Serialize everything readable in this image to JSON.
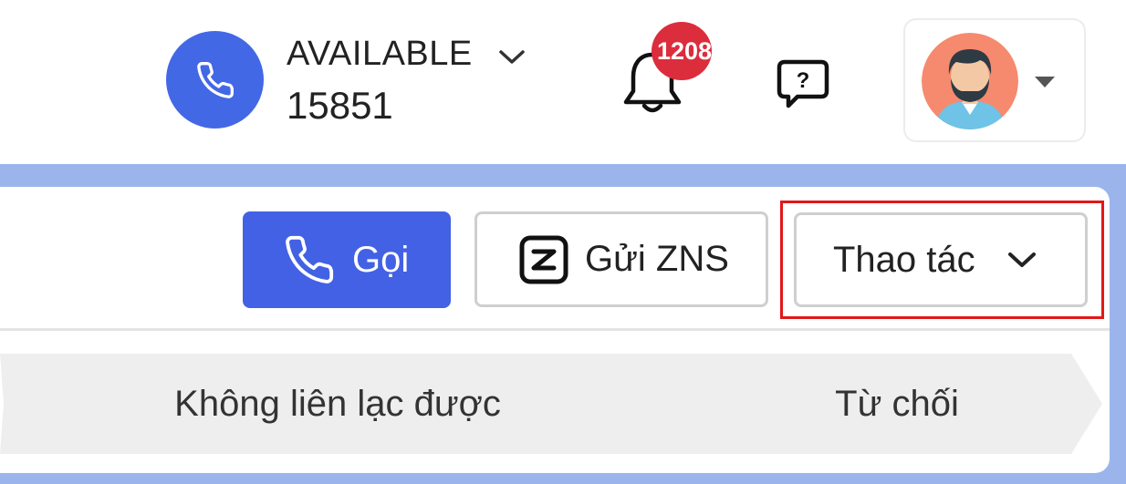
{
  "header": {
    "agent_status": "AVAILABLE",
    "extension": "15851",
    "notification_count": "1208",
    "icons": {
      "call_status": "phone-icon",
      "status_dropdown": "chevron-down-icon",
      "notifications": "bell-icon",
      "help": "help-chat-icon",
      "user_menu": "caret-down-icon"
    }
  },
  "toolbar": {
    "call_label": "Gọi",
    "zns_label": "Gửi ZNS",
    "actions_label": "Thao tác"
  },
  "pipeline": {
    "stages": [
      {
        "label": "Không liên lạc được"
      },
      {
        "label": "Từ chối"
      }
    ]
  },
  "colors": {
    "primary": "#4361e4",
    "badge": "#dc2d3d",
    "band": "#9bb5ec",
    "highlight": "#e21818",
    "avatar_bg": "#f58a6e"
  }
}
